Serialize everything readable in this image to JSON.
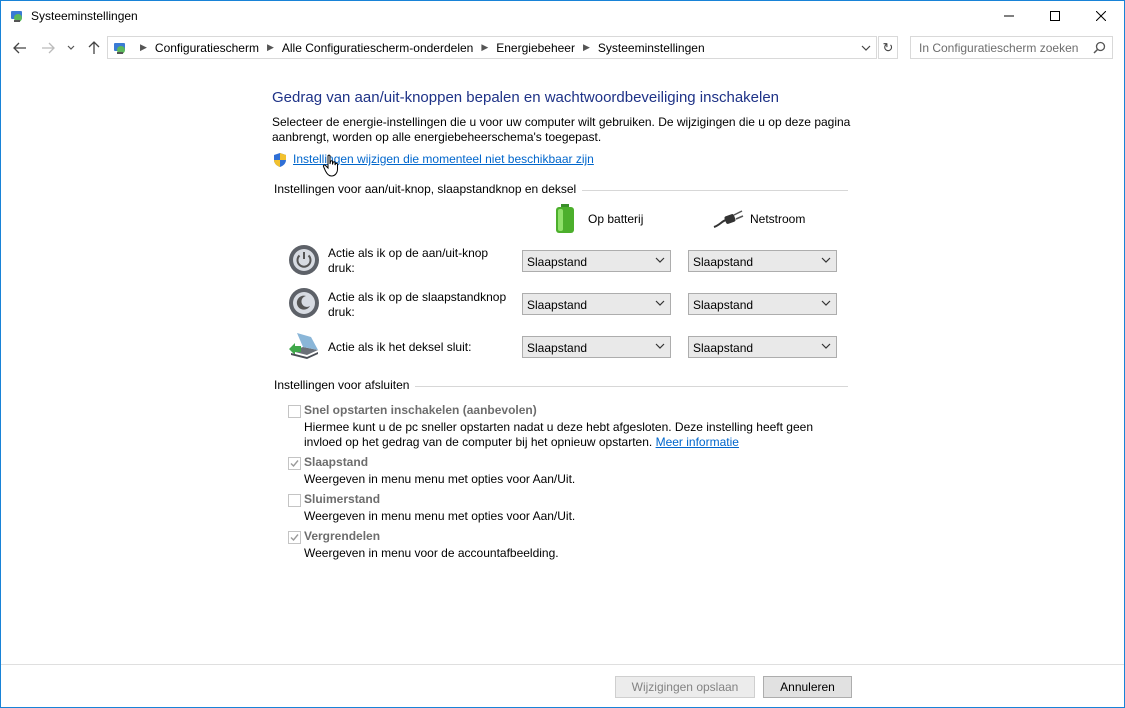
{
  "window": {
    "title": "Systeeminstellingen"
  },
  "breadcrumb": [
    "Configuratiescherm",
    "Alle Configuratiescherm-onderdelen",
    "Energiebeheer",
    "Systeeminstellingen"
  ],
  "search": {
    "placeholder": "In Configuratiescherm zoeken"
  },
  "page": {
    "heading": "Gedrag van aan/uit-knoppen bepalen en wachtwoordbeveiliging inschakelen",
    "description": "Selecteer de energie-instellingen die u voor uw computer wilt gebruiken. De wijzigingen die u op deze pagina aanbrengt, worden op alle energiebeheerschema's toegepast.",
    "change_link": "Instellingen wijzigen die momenteel niet beschikbaar zijn"
  },
  "buttons_section": {
    "title": "Instellingen voor aan/uit-knop, slaapstandknop en deksel",
    "col_battery": "Op batterij",
    "col_ac": "Netstroom",
    "rows": [
      {
        "label": "Actie als ik op de aan/uit-knop druk:",
        "battery": "Slaapstand",
        "ac": "Slaapstand",
        "icon": "power-button-icon"
      },
      {
        "label": "Actie als ik op de slaapstandknop druk:",
        "battery": "Slaapstand",
        "ac": "Slaapstand",
        "icon": "sleep-button-icon"
      },
      {
        "label": "Actie als ik het deksel sluit:",
        "battery": "Slaapstand",
        "ac": "Slaapstand",
        "icon": "laptop-lid-icon"
      }
    ]
  },
  "shutdown_section": {
    "title": "Instellingen voor afsluiten",
    "items": [
      {
        "title": "Snel opstarten inschakelen (aanbevolen)",
        "desc": "Hiermee kunt u de pc sneller opstarten nadat u deze hebt afgesloten. Deze instelling heeft geen invloed op het gedrag van de computer bij het opnieuw opstarten.",
        "link": "Meer informatie",
        "checked": false
      },
      {
        "title": "Slaapstand",
        "desc": "Weergeven in menu menu met opties voor Aan/Uit.",
        "checked": true
      },
      {
        "title": "Sluimerstand",
        "desc": "Weergeven in menu menu met opties voor Aan/Uit.",
        "checked": false
      },
      {
        "title": "Vergrendelen",
        "desc": "Weergeven in menu voor de accountafbeelding.",
        "checked": true
      }
    ]
  },
  "footer": {
    "save": "Wijzigingen opslaan",
    "cancel": "Annuleren"
  },
  "colors": {
    "accent": "#1883d7",
    "heading": "#1e3287",
    "link": "#0066cc"
  }
}
